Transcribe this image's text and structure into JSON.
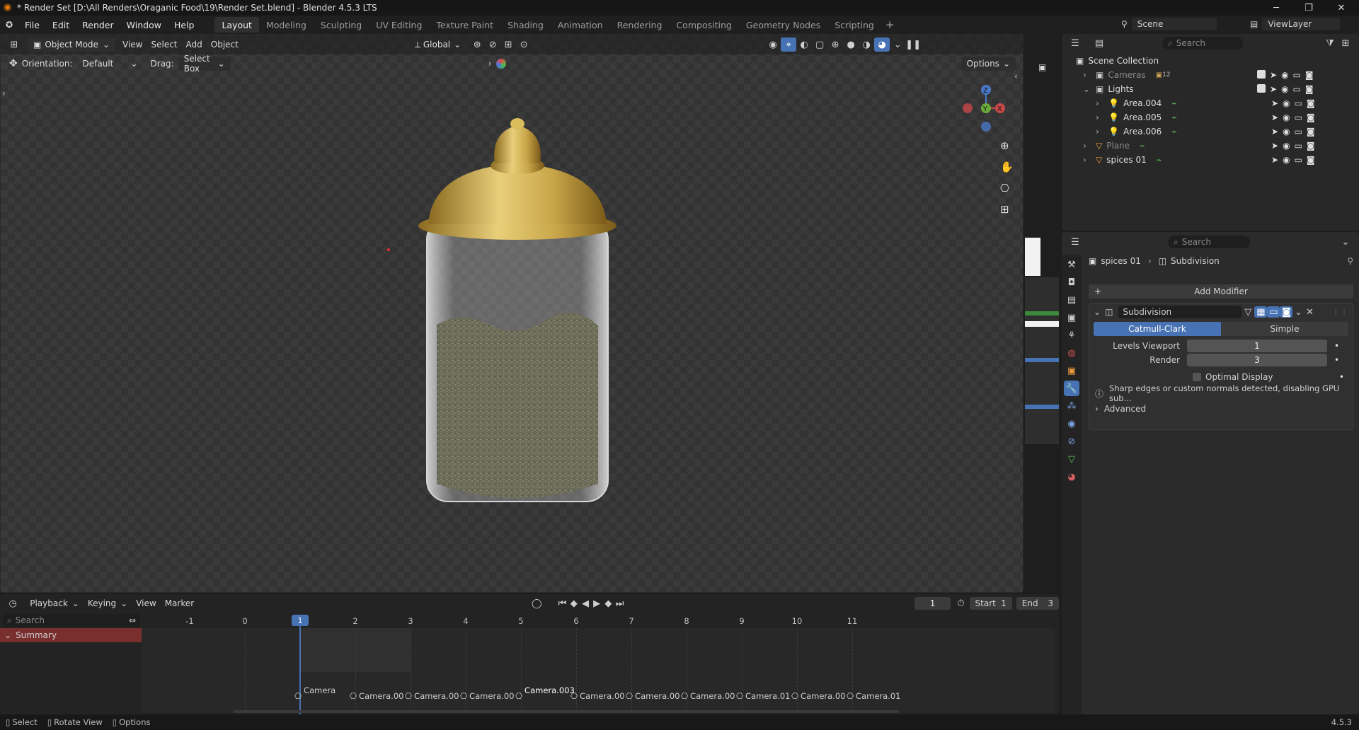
{
  "window": {
    "title": "* Render Set [D:\\All Renders\\Oraganic Food\\19\\Render Set.blend] - Blender 4.5.3 LTS",
    "minimize": "─",
    "maximize": "❐",
    "close": "✕"
  },
  "menu": [
    "File",
    "Edit",
    "Render",
    "Window",
    "Help"
  ],
  "workspaces": [
    "Layout",
    "Modeling",
    "Sculpting",
    "UV Editing",
    "Texture Paint",
    "Shading",
    "Animation",
    "Rendering",
    "Compositing",
    "Geometry Nodes",
    "Scripting"
  ],
  "topright": {
    "scene": "Scene",
    "view_layer": "ViewLayer"
  },
  "viewport": {
    "mode": "Object Mode",
    "menus": [
      "View",
      "Select",
      "Add",
      "Object"
    ],
    "transform": "Global",
    "orientation_label": "Orientation:",
    "orientation": "Default",
    "drag_label": "Drag:",
    "drag": "Select Box",
    "options": "Options"
  },
  "outliner": {
    "search_placeholder": "Search",
    "root": "Scene Collection",
    "items": [
      {
        "label": "Cameras",
        "count": "12",
        "dim": true
      },
      {
        "label": "Lights",
        "dim": false
      },
      {
        "label": "Area.004",
        "dim": false
      },
      {
        "label": "Area.005",
        "dim": false
      },
      {
        "label": "Area.006",
        "dim": false
      },
      {
        "label": "Plane",
        "dim": true
      },
      {
        "label": "spices 01",
        "dim": false
      }
    ]
  },
  "properties": {
    "search_placeholder": "Search",
    "breadcrumb_object": "spices 01",
    "breadcrumb_modifier": "Subdivision",
    "add_modifier": "Add Modifier",
    "modifier_name": "Subdivision",
    "mode_a": "Catmull-Clark",
    "mode_b": "Simple",
    "levels_viewport_label": "Levels Viewport",
    "levels_viewport": "1",
    "render_label": "Render",
    "render": "3",
    "optimal_display": "Optimal Display",
    "warning": "Sharp edges or custom normals detected, disabling GPU sub...",
    "advanced": "Advanced"
  },
  "timeline": {
    "menus": [
      "Playback",
      "Keying",
      "View",
      "Marker"
    ],
    "current_frame": "1",
    "start_label": "Start",
    "start": "1",
    "end_label": "End",
    "end": "3",
    "search_placeholder": "Search",
    "summary": "Summary",
    "ticks": [
      "-1",
      "0",
      "1",
      "2",
      "3",
      "4",
      "5",
      "6",
      "7",
      "8",
      "9",
      "10",
      "11"
    ],
    "markers": [
      "Camera",
      "Camera.00",
      "Camera.00",
      "Camera.00",
      "Camera.003",
      "Camera.00",
      "Camera.00",
      "Camera.00",
      "Camera.01",
      "Camera.00",
      "Camera.01"
    ]
  },
  "status": {
    "select": "Select",
    "rotate": "Rotate View",
    "options": "Options",
    "version": "4.5.3"
  },
  "colors": {
    "accent": "#4772b3",
    "summary": "#7a2f2f",
    "brass": "#c8a548"
  }
}
